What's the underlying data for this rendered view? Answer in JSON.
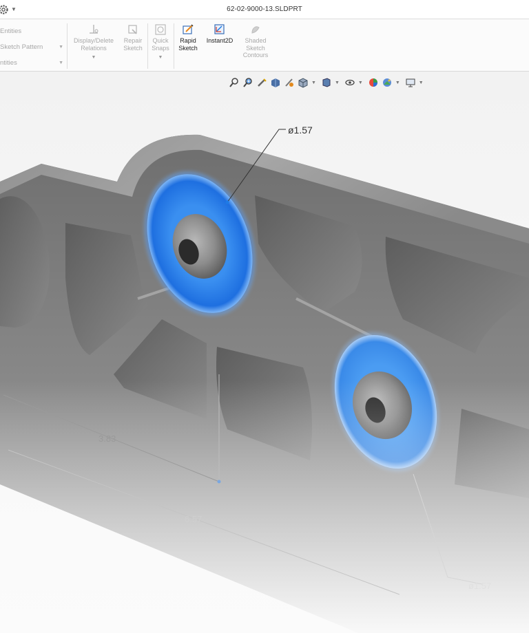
{
  "window": {
    "title": "62-02-9000-13.SLDPRT",
    "gear_icon": "gear-icon"
  },
  "ribbon": {
    "left_rows": [
      {
        "label": "Entities",
        "has_dropdown": false
      },
      {
        "label": "Sketch Pattern",
        "has_dropdown": true
      },
      {
        "label": "ntities",
        "has_dropdown": true
      }
    ],
    "tools": [
      {
        "id": "display-delete-relations",
        "label_line1": "Display/Delete",
        "label_line2": "Relations",
        "enabled": false,
        "has_dropdown": true,
        "icon": "relations-icon"
      },
      {
        "id": "repair-sketch",
        "label_line1": "Repair",
        "label_line2": "Sketch",
        "enabled": false,
        "has_dropdown": false,
        "icon": "repair-sketch-icon"
      },
      {
        "id": "quick-snaps",
        "label_line1": "Quick",
        "label_line2": "Snaps",
        "enabled": false,
        "has_dropdown": true,
        "icon": "quick-snaps-icon"
      },
      {
        "id": "rapid-sketch",
        "label_line1": "Rapid",
        "label_line2": "Sketch",
        "enabled": true,
        "has_dropdown": false,
        "icon": "rapid-sketch-icon"
      },
      {
        "id": "instant2d",
        "label_line1": "Instant2D",
        "label_line2": "",
        "enabled": true,
        "has_dropdown": false,
        "icon": "instant2d-icon"
      },
      {
        "id": "shaded-sketch-contours",
        "label_line1": "Shaded",
        "label_line2": "Sketch",
        "label_line3": "Contours",
        "enabled": false,
        "has_dropdown": false,
        "icon": "shaded-contours-icon"
      }
    ]
  },
  "heads_up_toolbar": [
    "zoom-to-fit-icon",
    "zoom-to-area-icon",
    "previous-view-icon",
    "section-view-icon",
    "dynamic-annotation-icon",
    "view-orientation-icon",
    "display-style-icon",
    "hide-show-items-icon",
    "edit-appearance-icon",
    "apply-scene-icon",
    "view-settings-icon"
  ],
  "viewport": {
    "dimensions": {
      "hole_diameter_top": "ø1.57",
      "hole_diameter_bottom": "ø1.57",
      "length_short": "3.83",
      "length_long": "6.57"
    },
    "highlight_color": "#1e7be6"
  }
}
